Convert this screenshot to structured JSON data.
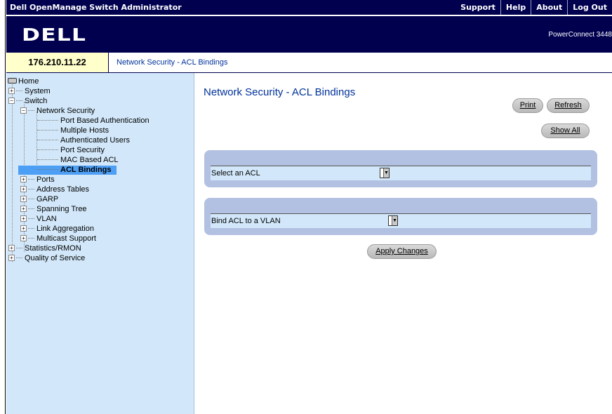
{
  "header": {
    "app_title": "Dell OpenManage Switch Administrator",
    "links": [
      "Support",
      "Help",
      "About",
      "Log Out"
    ],
    "logo": "DELL",
    "model": "PowerConnect 3448"
  },
  "ip_address": "176.210.11.22",
  "breadcrumb": "Network Security - ACL Bindings",
  "tree": {
    "home": "Home",
    "system": "System",
    "switch": "Switch",
    "network_security": "Network Security",
    "port_based_auth": "Port Based Authentication",
    "multiple_hosts": "Multiple Hosts",
    "authenticated_users": "Authenticated Users",
    "port_security": "Port Security",
    "mac_based_acl": "MAC Based ACL",
    "acl_bindings": "ACL Bindings",
    "ports": "Ports",
    "address_tables": "Address Tables",
    "garp": "GARP",
    "spanning_tree": "Spanning Tree",
    "vlan": "VLAN",
    "link_aggregation": "Link Aggregation",
    "multicast_support": "Multicast Support",
    "statistics_rmon": "Statistics/RMON",
    "quality_of_service": "Quality of Service"
  },
  "main": {
    "title": "Network Security - ACL Bindings",
    "print_label": "Print",
    "refresh_label": "Refresh",
    "show_all_label": "Show All",
    "select_acl_label": "Select an ACL",
    "select_acl_value": "",
    "bind_vlan_label": "Bind ACL to a VLAN",
    "bind_vlan_value": "",
    "apply_label": "Apply Changes"
  },
  "colors": {
    "header_bg": "#00004f",
    "tree_bg": "#d2e8fa",
    "selected_bg": "#4d9ff5",
    "panel_bg": "#b2c0e1",
    "title_blue": "#00329b",
    "ip_bg": "#ffffcc"
  }
}
